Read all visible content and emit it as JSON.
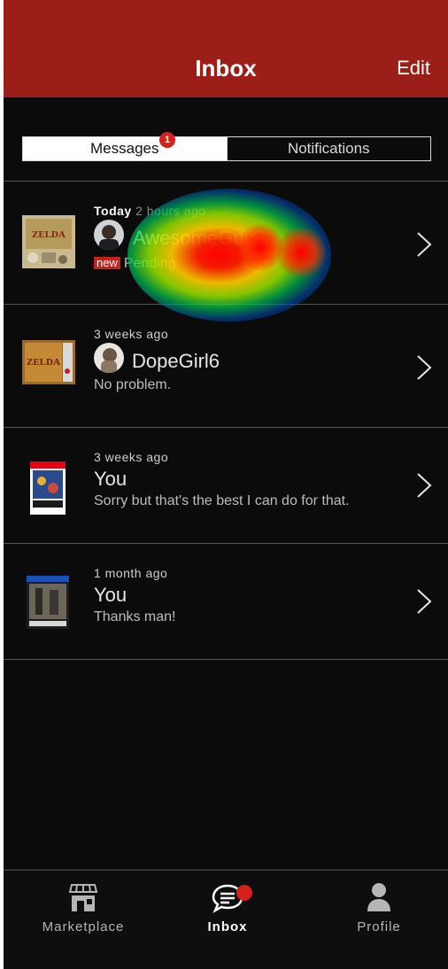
{
  "header": {
    "title": "Inbox",
    "edit_label": "Edit"
  },
  "tabs": [
    {
      "label": "Messages",
      "active": true,
      "badge": "1"
    },
    {
      "label": "Notifications",
      "active": false
    }
  ],
  "threads": [
    {
      "time_prefix": "Today",
      "time": "2 hours ago",
      "name": "AwesomeGuy2",
      "new_tag": "new",
      "snippet": "Pending",
      "thumbnail": "zelda-game-cover",
      "has_avatar": true
    },
    {
      "time_prefix": "",
      "time": "3 weeks ago",
      "name": "DopeGirl6",
      "snippet": "No problem.",
      "thumbnail": "ocarina-of-time-cartridge",
      "has_avatar": true
    },
    {
      "time_prefix": "",
      "time": "3 weeks ago",
      "name": "You",
      "snippet": "Sorry but that's the best I can do for that.",
      "thumbnail": "smash-bros-switch-case",
      "has_avatar": false
    },
    {
      "time_prefix": "",
      "time": "1 month ago",
      "name": "You",
      "snippet": "Thanks man!",
      "thumbnail": "division-2-ps4-case",
      "has_avatar": false
    }
  ],
  "bottom_nav": [
    {
      "label": "Marketplace",
      "icon": "storefront-icon",
      "active": false
    },
    {
      "label": "Inbox",
      "icon": "chat-bubble-icon",
      "active": true,
      "has_dot": true
    },
    {
      "label": "Profile",
      "icon": "person-icon",
      "active": false
    }
  ],
  "colors": {
    "header_bg": "#9b1e18",
    "background": "#0b0b0b",
    "badge": "#d3221c",
    "new_tag": "#c5221b"
  }
}
